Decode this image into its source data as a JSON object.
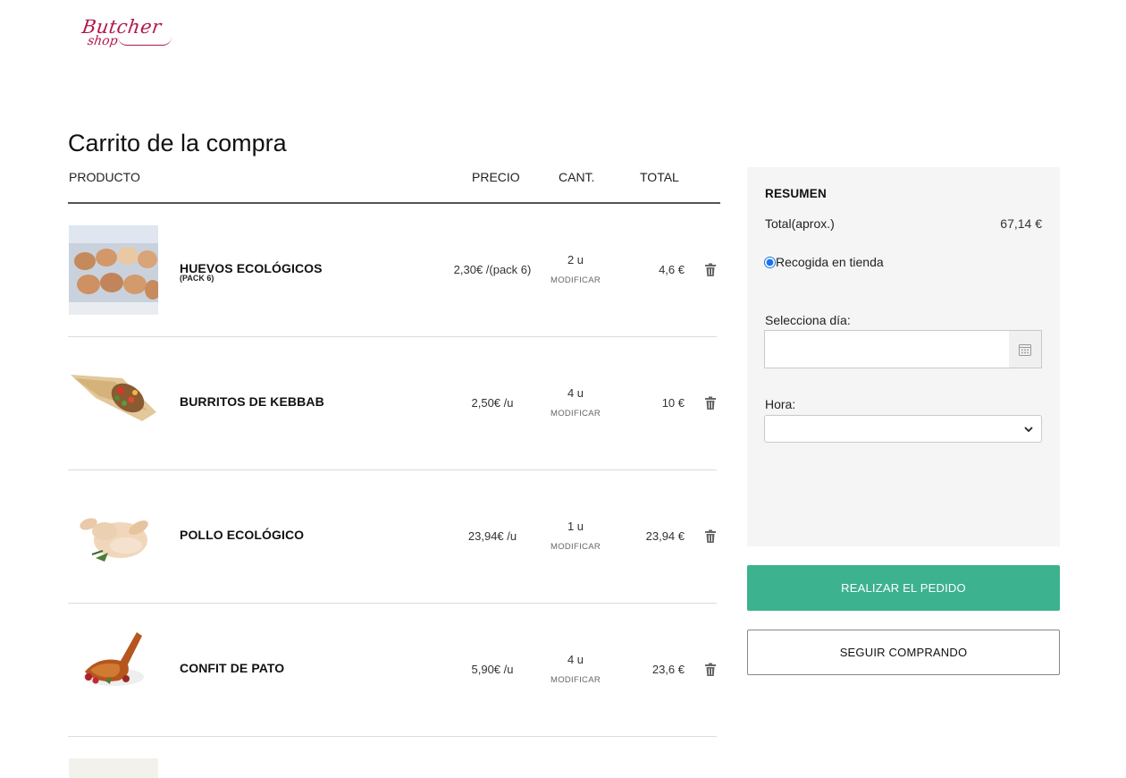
{
  "brand": {
    "line1": "Butcher",
    "line2": "shop",
    "color": "#b3164f"
  },
  "page_title": "Carrito de la compra",
  "columns": {
    "product": "PRODUCTO",
    "price": "PRECIO",
    "qty": "CANT.",
    "total": "TOTAL"
  },
  "items": [
    {
      "name": "HUEVOS ECOLÓGICOS",
      "sub": "(PACK 6)",
      "price": "2,30€ /(pack 6)",
      "qty": "2 u",
      "modify": "MODIFICAR",
      "total": "4,6 €",
      "image": "eggs"
    },
    {
      "name": "BURRITOS DE KEBBAB",
      "sub": "",
      "price": "2,50€ /u",
      "qty": "4 u",
      "modify": "MODIFICAR",
      "total": "10 €",
      "image": "burrito"
    },
    {
      "name": "POLLO ECOLÓGICO",
      "sub": "",
      "price": "23,94€ /u",
      "qty": "1 u",
      "modify": "MODIFICAR",
      "total": "23,94 €",
      "image": "chicken"
    },
    {
      "name": "CONFIT DE PATO",
      "sub": "",
      "price": "5,90€ /u",
      "qty": "4 u",
      "modify": "MODIFICAR",
      "total": "23,6 €",
      "image": "duck"
    }
  ],
  "summary": {
    "title": "RESUMEN",
    "total_label": "Total(aprox.)",
    "total_value": "67,14 €",
    "pickup_label": "Recogida en tienda",
    "pickup_selected": true,
    "day_label": "Selecciona día:",
    "day_value": "",
    "hour_label": "Hora:",
    "hour_value": ""
  },
  "buttons": {
    "order": "REALIZAR EL PEDIDO",
    "continue": "SEGUIR COMPRANDO"
  },
  "colors": {
    "accent": "#3cb28e",
    "panel": "#f5f5f5",
    "radio": "#1a73e8"
  }
}
